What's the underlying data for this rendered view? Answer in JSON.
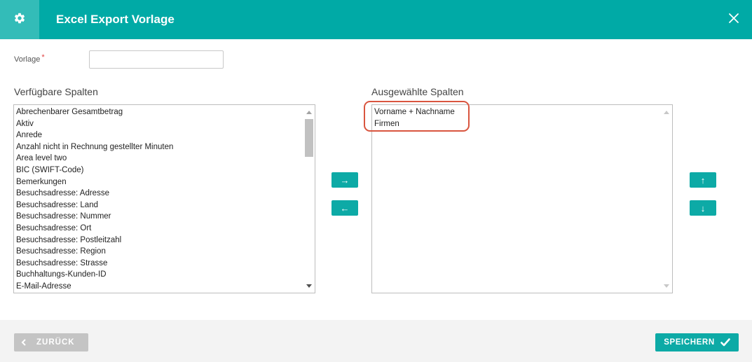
{
  "header": {
    "title": "Excel Export Vorlage",
    "icon": "gear-icon",
    "close_icon": "close-icon",
    "bg_color": "#00aaa6"
  },
  "form": {
    "vorlage_label": "Vorlage",
    "required_mark": "*",
    "vorlage_value": ""
  },
  "available": {
    "title": "Verfügbare Spalten",
    "items": [
      "Abrechenbarer Gesamtbetrag",
      "Aktiv",
      "Anrede",
      "Anzahl nicht in Rechnung gestellter Minuten",
      "Area level two",
      "BIC (SWIFT-Code)",
      "Bemerkungen",
      "Besuchsadresse: Adresse",
      "Besuchsadresse: Land",
      "Besuchsadresse: Nummer",
      "Besuchsadresse: Ort",
      "Besuchsadresse: Postleitzahl",
      "Besuchsadresse: Region",
      "Besuchsadresse: Strasse",
      "Buchhaltungs-Kunden-ID",
      "E-Mail-Adresse"
    ]
  },
  "selected": {
    "title": "Ausgewählte Spalten",
    "items": [
      "Vorname + Nachname",
      "Firmen"
    ]
  },
  "transfer": {
    "add_label": "→",
    "remove_label": "←",
    "move_up_label": "↑",
    "move_down_label": "↓"
  },
  "footer": {
    "back_label": "ZURÜCK",
    "save_label": "SPEICHERN"
  },
  "colors": {
    "accent": "#0daaa6",
    "highlight": "#d9553f",
    "required": "#e04040"
  }
}
